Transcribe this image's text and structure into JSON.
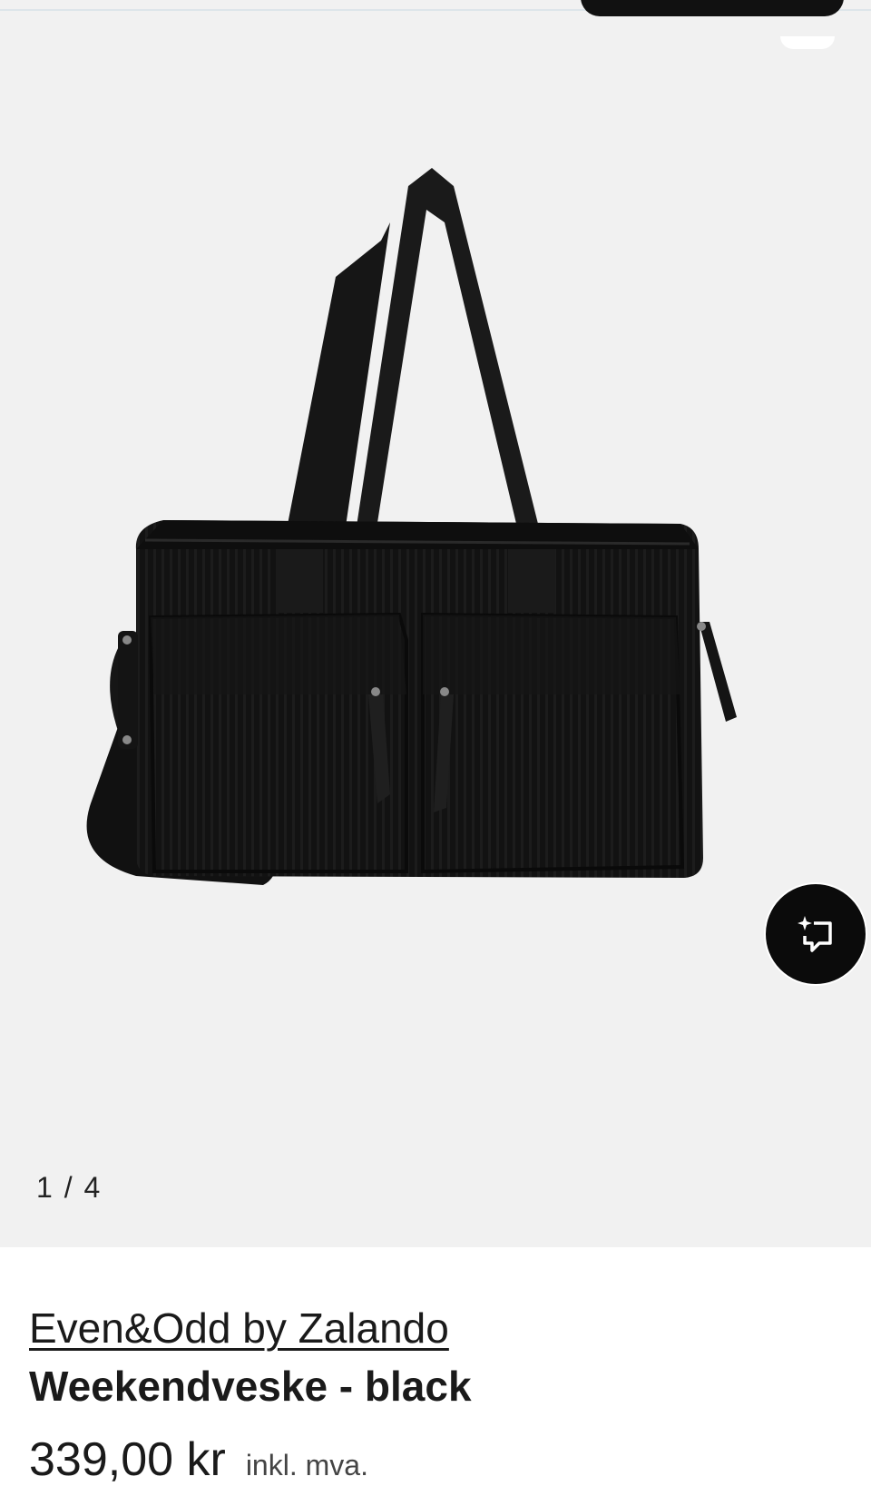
{
  "gallery": {
    "image_alt": "Even&Odd by Zalando Weekendveske - black",
    "counter": "1 / 4",
    "ai_button_icon": "sparkle-chat-icon"
  },
  "product": {
    "brand": "Even&Odd by Zalando",
    "title": "Weekendveske - black",
    "price": "339,00 kr",
    "vat_note": "inkl. mva."
  },
  "colors": {
    "gallery_bg": "#f1f1f1",
    "bag": "#141414",
    "button_bg": "#0b0b0b"
  }
}
